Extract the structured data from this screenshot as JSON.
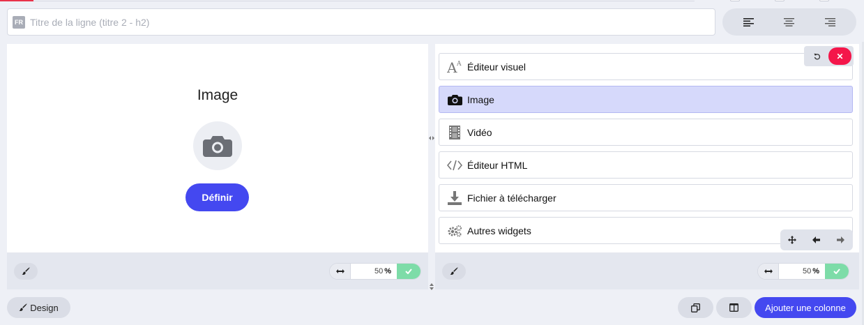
{
  "title_row": {
    "lang_badge": "FR",
    "placeholder": "Titre de la ligne (titre 2 - h2)"
  },
  "alignment": {
    "options": [
      "align-left-icon",
      "align-center-icon",
      "align-right-icon"
    ]
  },
  "left_column": {
    "block_title": "Image",
    "define_label": "Définir",
    "width_value": "50",
    "width_unit": "%"
  },
  "right_column": {
    "widgets": [
      {
        "label": "Éditeur visuel",
        "icon": "text-editor-icon"
      },
      {
        "label": "Image",
        "icon": "camera-icon",
        "active": true
      },
      {
        "label": "Vidéo",
        "icon": "film-icon"
      },
      {
        "label": "Éditeur HTML",
        "icon": "code-icon"
      },
      {
        "label": "Fichier à télécharger",
        "icon": "download-icon"
      },
      {
        "label": "Autres widgets",
        "icon": "gears-icon"
      }
    ],
    "width_value": "50",
    "width_unit": "%"
  },
  "footer": {
    "design_label": "Design",
    "add_column_label": "Ajouter une colonne"
  },
  "colors": {
    "primary": "#4448f0",
    "active_widget_bg": "#d6d9fb",
    "danger": "#f4164a",
    "success": "#7ddca8"
  }
}
